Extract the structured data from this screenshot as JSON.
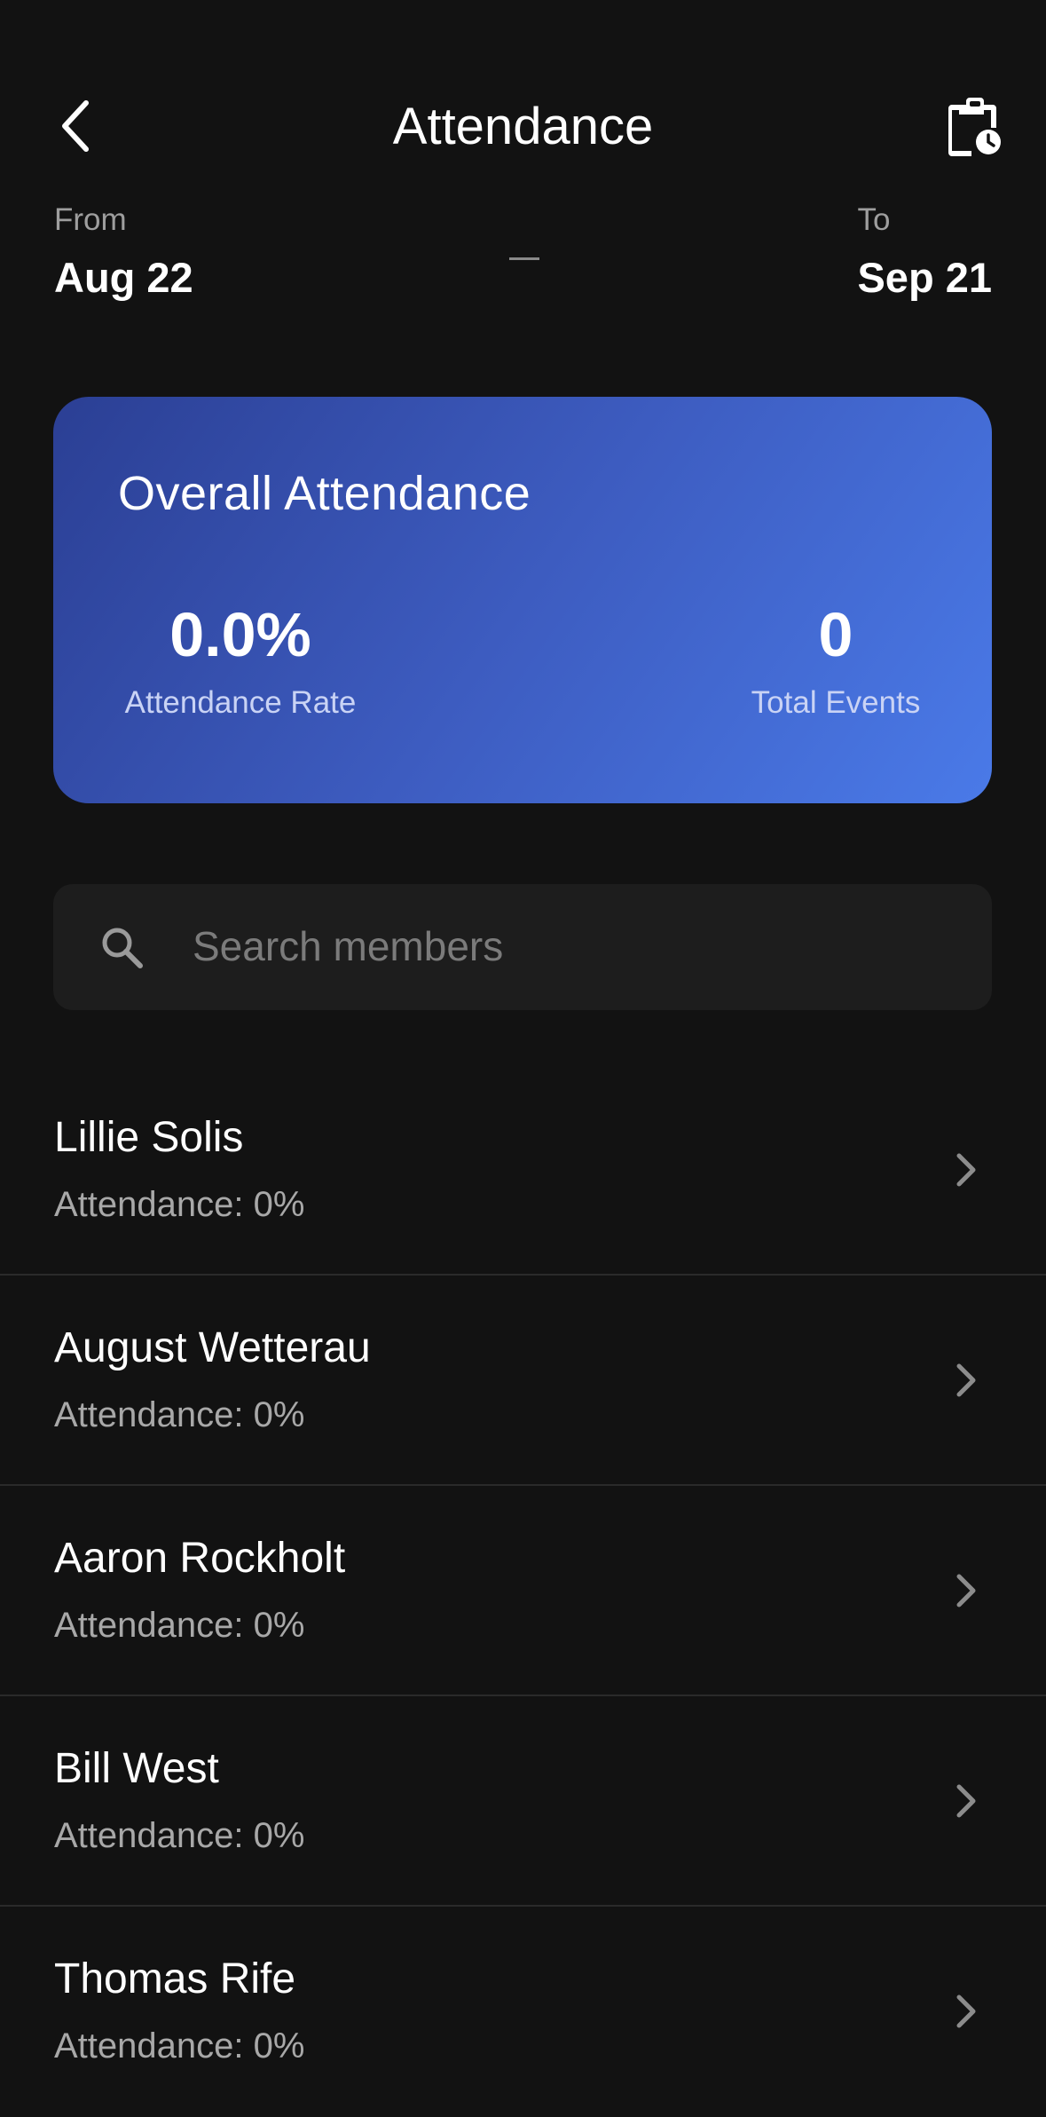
{
  "header": {
    "title": "Attendance",
    "back_icon": "chevron-left-icon",
    "history_icon": "clipboard-clock-icon"
  },
  "date_range": {
    "from_label": "From",
    "from_value": "Aug 22",
    "to_label": "To",
    "to_value": "Sep 21"
  },
  "overall": {
    "title": "Overall Attendance",
    "rate_value": "0.0%",
    "rate_label": "Attendance Rate",
    "events_value": "0",
    "events_label": "Total Events",
    "gradient_start": "#2b3f94",
    "gradient_end": "#4a7ae8"
  },
  "search": {
    "placeholder": "Search members",
    "icon": "search-icon"
  },
  "members": [
    {
      "name": "Lillie Solis",
      "attendance": "Attendance: 0%"
    },
    {
      "name": "August Wetterau",
      "attendance": "Attendance: 0%"
    },
    {
      "name": "Aaron Rockholt",
      "attendance": "Attendance: 0%"
    },
    {
      "name": "Bill West",
      "attendance": "Attendance: 0%"
    },
    {
      "name": "Thomas Rife",
      "attendance": "Attendance: 0%"
    }
  ],
  "colors": {
    "background": "#121212",
    "surface": "#1d1d1d",
    "secondary_text": "#a8a8a8"
  }
}
